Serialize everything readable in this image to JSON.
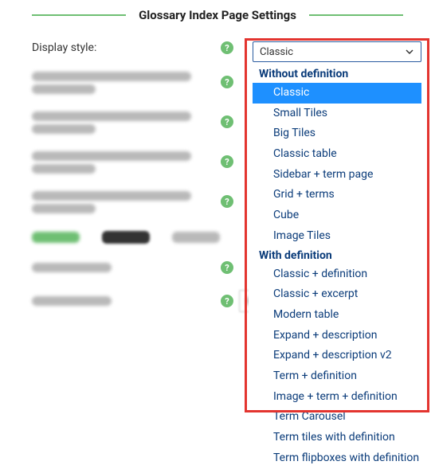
{
  "header": {
    "title": "Glossary Index Page Settings"
  },
  "fields": {
    "display_style": {
      "label": "Display style:"
    }
  },
  "select": {
    "current": "Classic",
    "groups": [
      {
        "label": "Without definition",
        "options": [
          "Classic",
          "Small Tiles",
          "Big Tiles",
          "Classic table",
          "Sidebar + term page",
          "Grid + terms",
          "Cube",
          "Image Tiles"
        ]
      },
      {
        "label": "With definition",
        "options": [
          "Classic + definition",
          "Classic + excerpt",
          "Modern table",
          "Expand + description",
          "Expand + description v2",
          "Term + definition",
          "Image + term + definition",
          "Term Carousel",
          "Term tiles with definition",
          "Term flipboxes with definition"
        ]
      }
    ],
    "selected_option": "Classic"
  }
}
